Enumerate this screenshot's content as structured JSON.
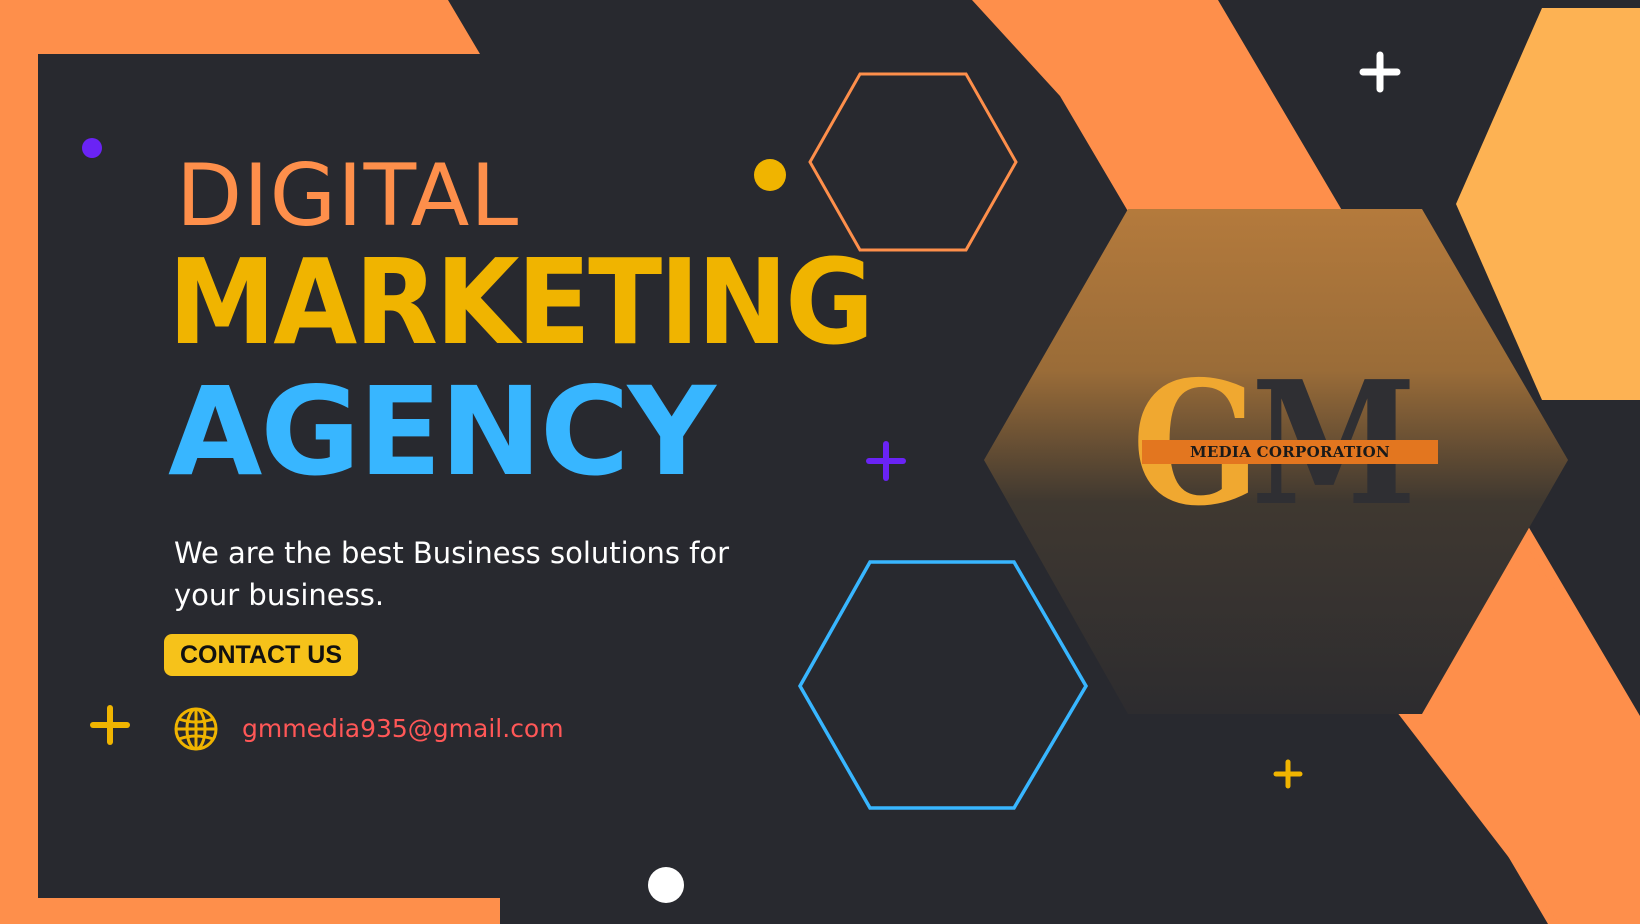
{
  "colors": {
    "background": "#28292f",
    "accent_orange": "#fe8f4b",
    "accent_light_orange": "#fdb253",
    "accent_yellow": "#f0b400",
    "accent_blue": "#38b6ff",
    "accent_purple": "#6a23f5",
    "email_red": "#ff5757",
    "logo_band": "#e3761f",
    "button_yellow": "#f6c21a"
  },
  "headline": {
    "line1": "DIGITAL",
    "line2": "MARKETING",
    "line3": "AGENCY"
  },
  "tagline": "We are the best Business solutions for your business.",
  "contact_button_label": "CONTACT US",
  "email": "gmmedia935@gmail.com",
  "logo": {
    "letter1": "G",
    "letter2": "M",
    "subtitle": "MEDIA CORPORATION"
  },
  "icons": {
    "globe": "globe-icon",
    "plus": "plus-icon",
    "dot": "dot-icon",
    "hexagon": "hexagon-outline"
  }
}
